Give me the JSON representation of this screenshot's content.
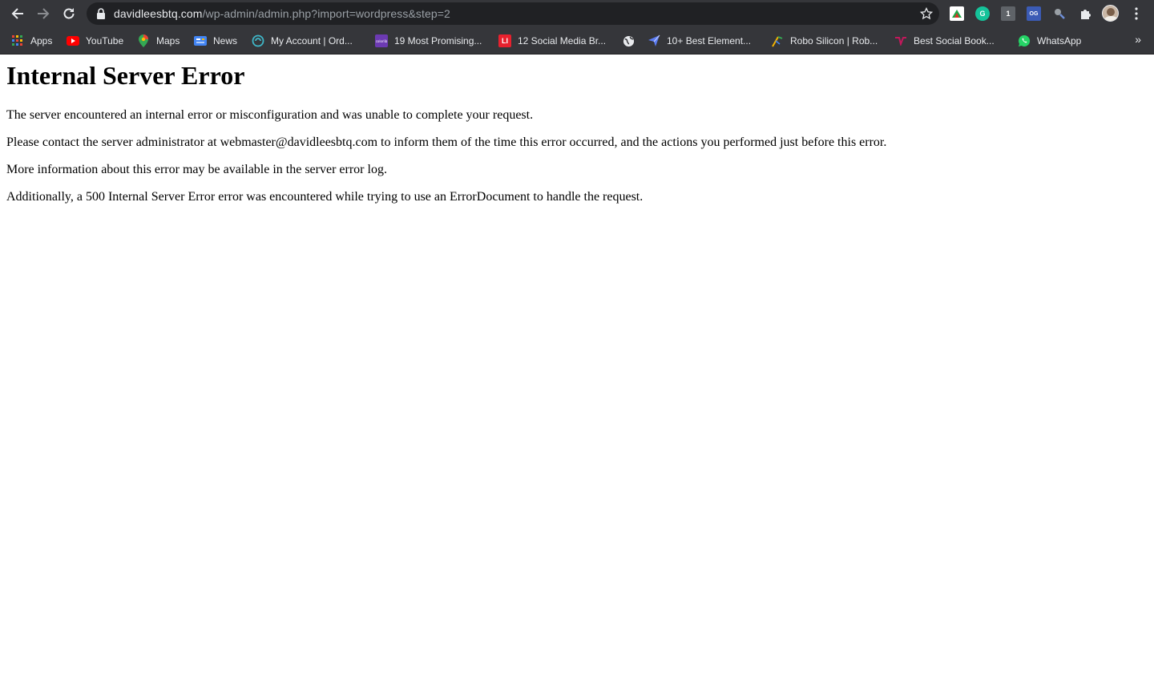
{
  "browser": {
    "url_host": "davidleesbtq.com",
    "url_path": "/wp-admin/admin.php?import=wordpress&step=2",
    "extensions": [
      {
        "icon": "adblock-icon"
      },
      {
        "icon": "grammarly-icon",
        "text": "G"
      },
      {
        "icon": "onetab-icon",
        "text": "1"
      },
      {
        "icon": "og-icon",
        "text": "OG"
      },
      {
        "icon": "search-extension-icon"
      },
      {
        "icon": "puzzle-icon"
      }
    ]
  },
  "bookmarks": [
    {
      "label": "Apps",
      "icon": "apps-grid-icon"
    },
    {
      "label": "YouTube",
      "icon": "youtube-icon"
    },
    {
      "label": "Maps",
      "icon": "maps-pin-icon"
    },
    {
      "label": "News",
      "icon": "news-icon"
    },
    {
      "label": "My Account | Ord...",
      "icon": "account-icon"
    },
    {
      "label": "19 Most Promising...",
      "icon": "colorlib-icon",
      "badge": "colorlib"
    },
    {
      "label": "12 Social Media Br...",
      "icon": "li-icon",
      "badge": "LI"
    },
    {
      "label": "",
      "icon": "globe-icon"
    },
    {
      "label": "10+ Best Element...",
      "icon": "send-icon"
    },
    {
      "label": "Robo Silicon | Rob...",
      "icon": "robo-icon"
    },
    {
      "label": "Best Social Book...",
      "icon": "bookmark-site-icon"
    },
    {
      "label": "WhatsApp",
      "icon": "whatsapp-icon"
    }
  ],
  "page": {
    "heading": "Internal Server Error",
    "paragraphs": [
      "The server encountered an internal error or misconfiguration and was unable to complete your request.",
      "Please contact the server administrator at webmaster@davidleesbtq.com to inform them of the time this error occurred, and the actions you performed just before this error.",
      "More information about this error may be available in the server error log.",
      "Additionally, a 500 Internal Server Error error was encountered while trying to use an ErrorDocument to handle the request."
    ]
  }
}
